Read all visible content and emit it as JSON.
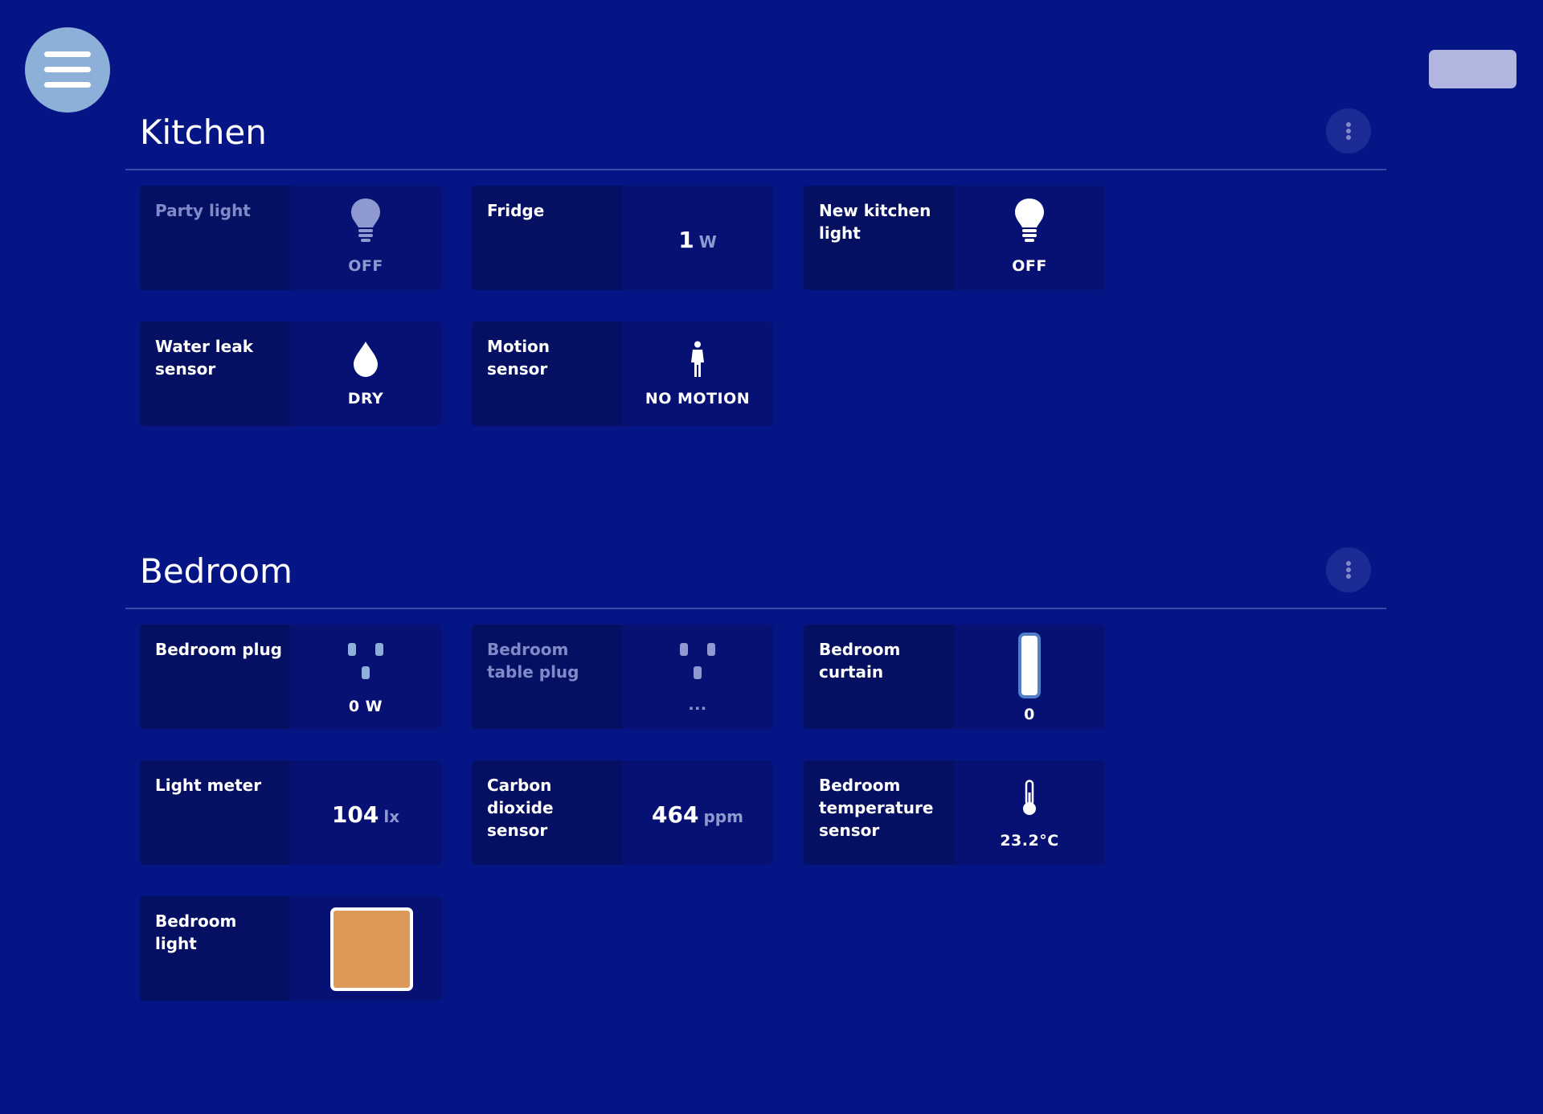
{
  "header": {
    "menu_icon": "hamburger-menu-icon"
  },
  "colors": {
    "background": "#061586",
    "card_name_panel": "#061062",
    "card_status_panel": "#071174",
    "muted_text": "#8e99d0",
    "menu_button": "#8cb0d8",
    "top_right_button": "#b1b6e0"
  },
  "sections": {
    "kitchen": {
      "title": "Kitchen",
      "cards": {
        "party_light": {
          "name": "Party light",
          "icon": "light-bulb-icon",
          "status": "OFF",
          "disabled": true
        },
        "fridge": {
          "name": "Fridge",
          "value": "1",
          "unit": "W"
        },
        "new_kitchen_light": {
          "name": "New kitchen light",
          "icon": "light-bulb-icon",
          "status": "OFF"
        },
        "water_leak_sensor": {
          "name": "Water leak sensor",
          "icon": "water-drop-icon",
          "status": "DRY"
        },
        "motion_sensor": {
          "name": "Motion sensor",
          "icon": "person-icon",
          "status": "NO MOTION"
        }
      }
    },
    "bedroom": {
      "title": "Bedroom",
      "cards": {
        "bedroom_plug": {
          "name": "Bedroom plug",
          "icon": "power-plug-icon",
          "status": "0 W"
        },
        "bedroom_table_plug": {
          "name": "Bedroom table plug",
          "icon": "power-plug-icon",
          "status": "...",
          "disabled": true
        },
        "bedroom_curtain": {
          "name": "Bedroom curtain",
          "icon": "curtain-level-icon",
          "status": "0"
        },
        "light_meter": {
          "name": "Light meter",
          "value": "104",
          "unit": "lx"
        },
        "carbon_dioxide_sensor": {
          "name": "Carbon dioxide sensor",
          "value": "464",
          "unit": "ppm"
        },
        "bedroom_temperature_sensor": {
          "name": "Bedroom temperature sensor",
          "icon": "thermometer-icon",
          "status": "23.2°C"
        },
        "bedroom_light": {
          "name": "Bedroom light",
          "color": "#de9857"
        }
      }
    }
  }
}
